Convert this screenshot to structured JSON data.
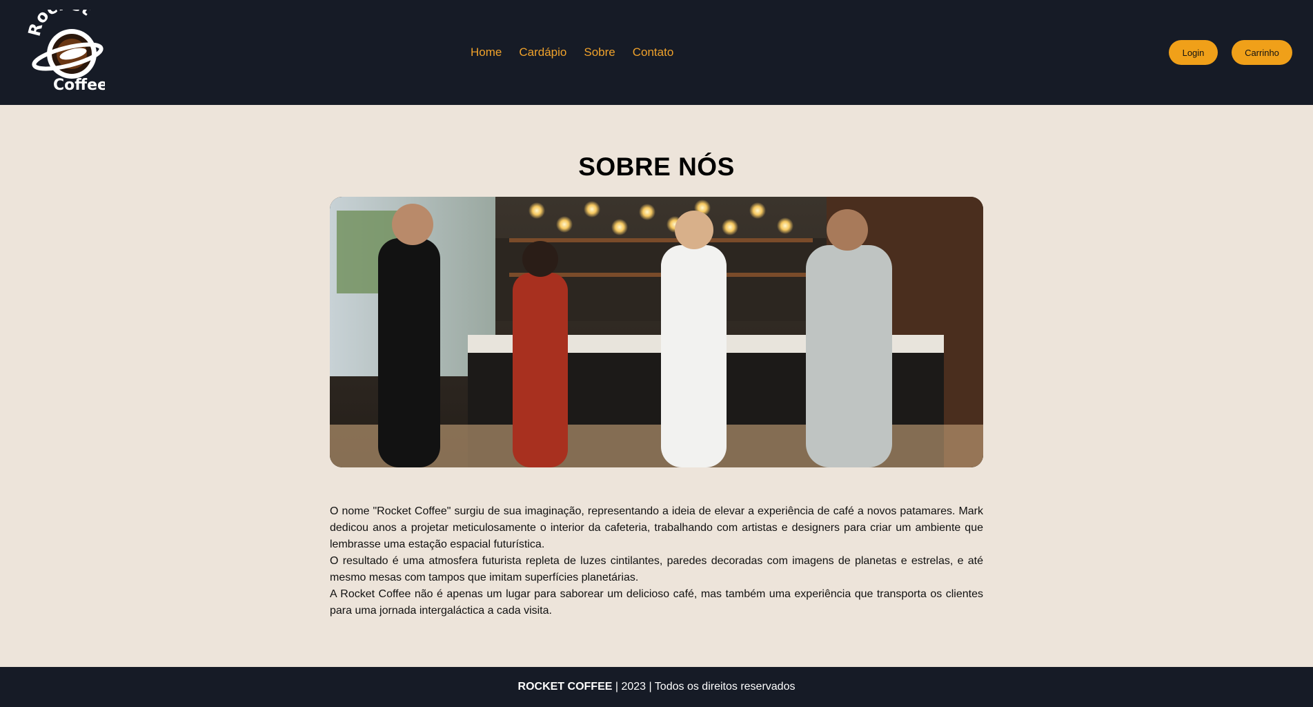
{
  "brand": {
    "logo_top_text": "Rocket",
    "logo_bottom_text": "Coffee"
  },
  "nav": {
    "items": [
      "Home",
      "Cardápio",
      "Sobre",
      "Contato"
    ]
  },
  "header_buttons": {
    "login_label": "Login",
    "cart_label": "Carrinho"
  },
  "main": {
    "title": "SOBRE NÓS",
    "paragraphs": [
      "O nome \"Rocket Coffee\" surgiu de sua imaginação, representando a ideia de elevar a experiência de café a novos patamares. Mark dedicou anos a projetar meticulosamente o interior da cafeteria, trabalhando com artistas e designers para criar um ambiente que lembrasse uma estação espacial futurística.",
      "O resultado é uma atmosfera futurista repleta de luzes cintilantes, paredes decoradas com imagens de planetas e estrelas, e até mesmo mesas com tampos que imitam superfícies planetárias.",
      "A Rocket Coffee não é apenas um lugar para saborear um delicioso café, mas também uma experiência que transporta os clientes para uma jornada intergaláctica a cada visita."
    ]
  },
  "footer": {
    "brand": "ROCKET COFFEE",
    "text": " | 2023 | Todos os direitos reservados"
  },
  "colors": {
    "header_bg": "#161B26",
    "page_bg": "#EDE4DA",
    "accent": "#F0A22B",
    "button_bg": "#F0A019"
  },
  "icons": {
    "logo": "rocket-coffee-logo",
    "photo": "team-photo"
  }
}
